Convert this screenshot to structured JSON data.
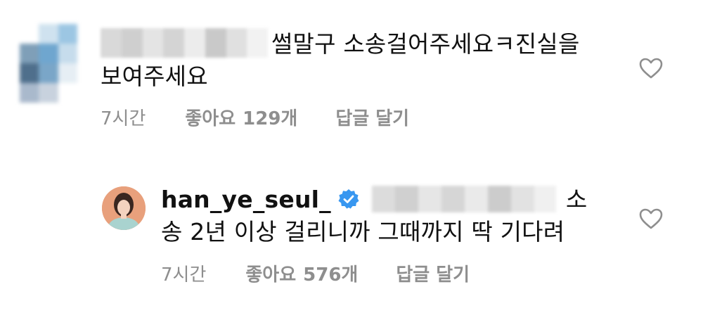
{
  "comments": [
    {
      "text_line1": "썰말구 소송걸어주세요ㅋ진실을",
      "text_line2": "보여주세요",
      "time": "7시간",
      "likes_label": "좋아요",
      "likes_count": "129개",
      "reply_label": "답글 달기",
      "icon": "heart-outline-icon"
    },
    {
      "username": "han_ye_seul_",
      "verified_icon": "verified-badge-icon",
      "text_line1_tail": "소",
      "text_line2": "송 2년 이상 걸리니까 그때까지 딱 기다려",
      "time": "7시간",
      "likes_label": "좋아요",
      "likes_count": "576개",
      "reply_label": "답글 달기",
      "icon": "heart-outline-icon"
    }
  ],
  "colors": {
    "meta_text": "#8e8e8e",
    "body_text": "#111111",
    "verified_blue": "#3897f0",
    "avatar_bg": "#e8a07c"
  }
}
